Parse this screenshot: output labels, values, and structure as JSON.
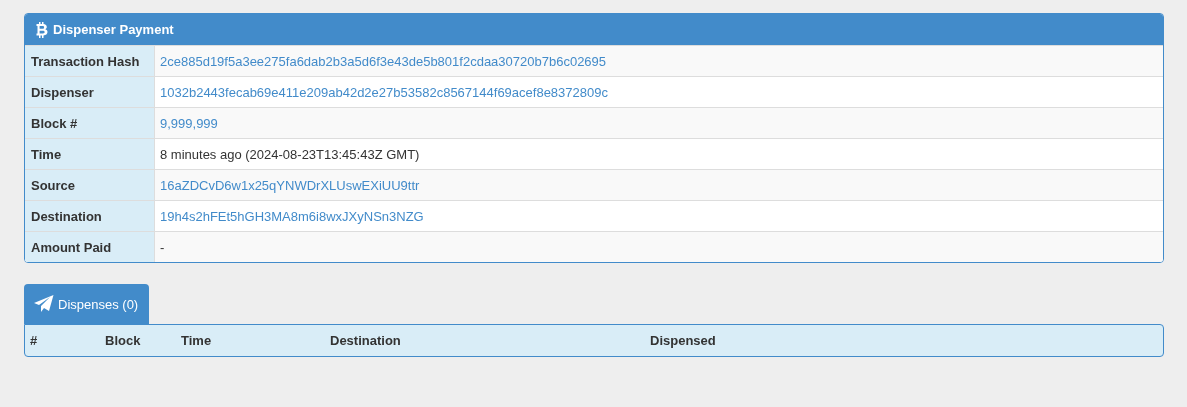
{
  "panel": {
    "title": "Dispenser Payment",
    "rows": [
      {
        "label": "Transaction Hash",
        "value": "2ce885d19f5a3ee275fa6dab2b3a5d6f3e43de5b801f2cdaa30720b7b6c02695",
        "kind": "link"
      },
      {
        "label": "Dispenser",
        "value": "1032b2443fecab69e411e209ab42d2e27b53582c8567144f69acef8e8372809c",
        "kind": "link"
      },
      {
        "label": "Block #",
        "value": "9,999,999",
        "kind": "link"
      },
      {
        "label": "Time",
        "value": "8 minutes ago (2024-08-23T13:45:43Z GMT)",
        "kind": "text"
      },
      {
        "label": "Source",
        "value": "16aZDCvD6w1x25qYNWDrXLUswEXiUU9ttr",
        "kind": "link"
      },
      {
        "label": "Destination",
        "value": "19h4s2hFEt5hGH3MA8m6i8wxJXyNSn3NZG",
        "kind": "link"
      },
      {
        "label": "Amount Paid",
        "value": "-",
        "kind": "text"
      }
    ]
  },
  "tabs": [
    {
      "label": "Dispenses (0)",
      "selected": true
    }
  ],
  "table": {
    "columns": [
      "#",
      "Block",
      "Time",
      "Destination",
      "Dispensed"
    ]
  }
}
